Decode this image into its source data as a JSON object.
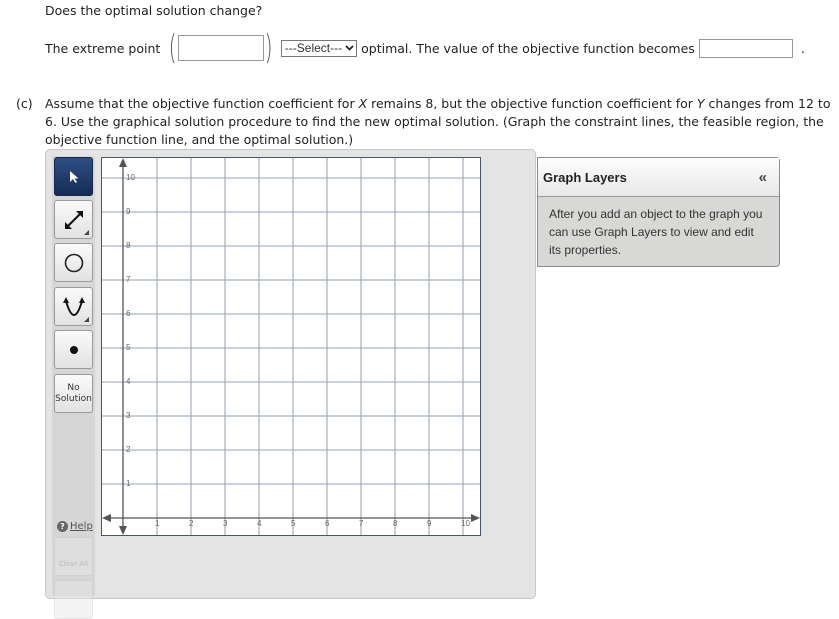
{
  "question": {
    "prompt": "Does the optimal solution change?",
    "extreme_point_label": "The extreme point",
    "extreme_point_value": "",
    "select_value": "---Select---",
    "after_select": "optimal. The value of the objective function becomes",
    "objective_value": "",
    "period": "."
  },
  "part_c": {
    "label": "(c)",
    "text_1": "Assume that the objective function coefficient for ",
    "var_x": "X",
    "text_2": " remains 8, but the objective function coefficient for ",
    "var_y": "Y",
    "text_3": " changes from 12 to 6. Use the graphical solution procedure to find the new optimal solution. (Graph the constraint lines, the feasible region, the objective function line, and the optimal solution.)"
  },
  "toolbar": {
    "tools": [
      {
        "name": "select-tool",
        "icon": "arrow-pointer-icon",
        "active": true
      },
      {
        "name": "line-tool",
        "icon": "double-arrow-line-icon",
        "active": false
      },
      {
        "name": "circle-tool",
        "icon": "circle-icon",
        "active": false
      },
      {
        "name": "parabola-tool",
        "icon": "parabola-icon",
        "active": false
      },
      {
        "name": "point-tool",
        "icon": "point-icon",
        "active": false
      }
    ],
    "no_solution_line1": "No",
    "no_solution_line2": "Solution",
    "help_label": "Help",
    "clear_all_label": "Clear All"
  },
  "graph": {
    "x_ticks": [
      "1",
      "2",
      "3",
      "4",
      "5",
      "6",
      "7",
      "8",
      "9",
      "10"
    ],
    "y_ticks": [
      "1",
      "2",
      "3",
      "4",
      "5",
      "6",
      "7",
      "8",
      "9",
      "10"
    ],
    "x_range": [
      0,
      10
    ],
    "y_range": [
      0,
      10
    ],
    "grid": true
  },
  "graph_layers": {
    "title": "Graph Layers",
    "collapse_icon": "«",
    "message": "After you add an object to the graph you can use Graph Layers to view and edit its properties."
  }
}
